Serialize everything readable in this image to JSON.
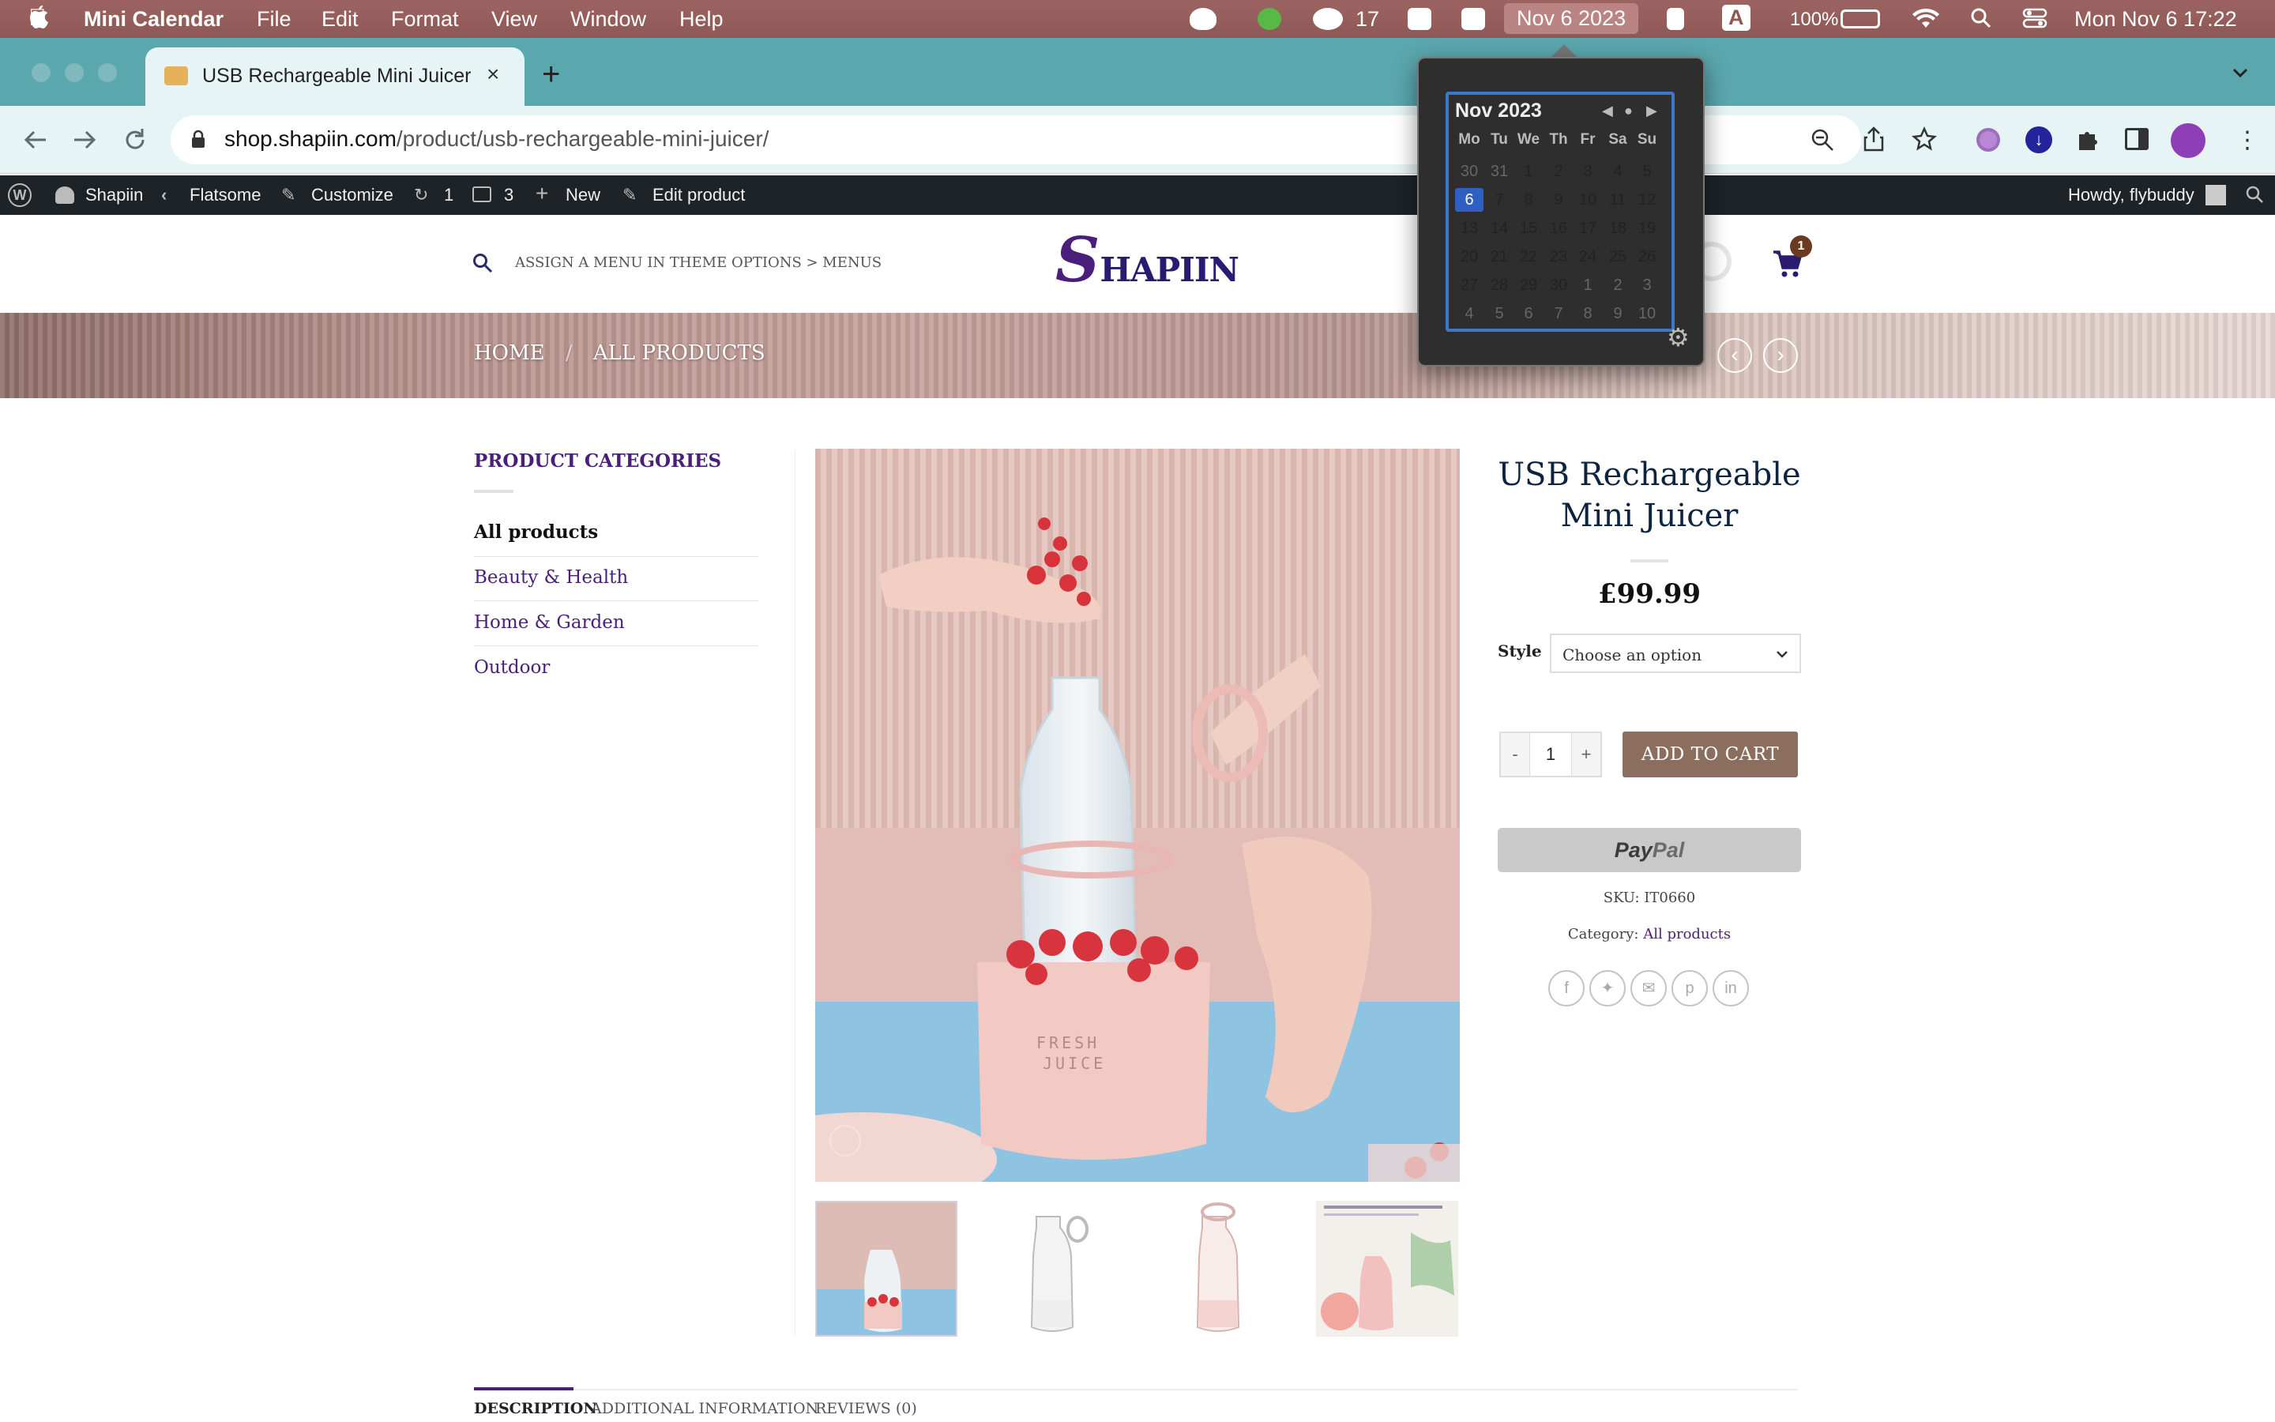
{
  "menubar": {
    "app_name": "Mini Calendar",
    "menus": [
      "File",
      "Edit",
      "Format",
      "View",
      "Window",
      "Help"
    ],
    "wechat_count": "17",
    "calendar_date": "Nov 6 2023",
    "input_source": "A",
    "battery": "100%",
    "clock": "Mon Nov 6  17:22"
  },
  "browser": {
    "tab_title": "USB Rechargeable Mini Juicer",
    "new_tab": "+",
    "url_host": "shop.shapiin.com",
    "url_path": "/product/usb-rechargeable-mini-juicer/"
  },
  "adminbar": {
    "site": "Shapiin",
    "theme": "Flatsome",
    "customize": "Customize",
    "updates": "1",
    "comments": "3",
    "new": "New",
    "edit": "Edit product",
    "howdy": "Howdy, flybuddy"
  },
  "calendar": {
    "title": "Nov 2023",
    "weekdays": [
      "Mo",
      "Tu",
      "We",
      "Th",
      "Fr",
      "Sa",
      "Su"
    ],
    "weeks": [
      [
        "30",
        "31",
        "1",
        "2",
        "3",
        "4",
        "5"
      ],
      [
        "6",
        "7",
        "8",
        "9",
        "10",
        "11",
        "12"
      ],
      [
        "13",
        "14",
        "15",
        "16",
        "17",
        "18",
        "19"
      ],
      [
        "20",
        "21",
        "22",
        "23",
        "24",
        "25",
        "26"
      ],
      [
        "27",
        "28",
        "29",
        "30",
        "1",
        "2",
        "3"
      ],
      [
        "4",
        "5",
        "6",
        "7",
        "8",
        "9",
        "10"
      ]
    ],
    "today": "6",
    "accent_color": "#3c78c8"
  },
  "site": {
    "menu_hint": "ASSIGN A MENU IN THEME OPTIONS > MENUS",
    "logo_s": "S",
    "logo_rest": "HAPIIN",
    "cart_count": "1",
    "breadcrumb_home": "HOME",
    "breadcrumb_sep": "/",
    "breadcrumb_current": "ALL PRODUCTS"
  },
  "sidebar": {
    "heading": "PRODUCT CATEGORIES",
    "items": [
      "All products",
      "Beauty & Health",
      "Home & Garden",
      "Outdoor"
    ]
  },
  "product": {
    "title_line1": "USB Rechargeable",
    "title_line2": "Mini Juicer",
    "price": "£99.99",
    "style_label": "Style",
    "style_placeholder": "Choose an option",
    "qty_minus": "-",
    "qty": "1",
    "qty_plus": "+",
    "add_to_cart": "ADD TO CART",
    "paypal_pay": "Pay",
    "paypal_pal": "Pal",
    "sku_label": "SKU:",
    "sku": "IT0660",
    "category_label": "Category:",
    "category": "All products",
    "image_label_line1": "FRESH",
    "image_label_line2": "JUICE"
  },
  "tabs": [
    "DESCRIPTION",
    "ADDITIONAL INFORMATION",
    "REVIEWS (0)"
  ],
  "colors": {
    "brand_purple": "#4a1f7a",
    "cart_button": "#8c6e5e",
    "admin_bar": "#1d2327"
  }
}
